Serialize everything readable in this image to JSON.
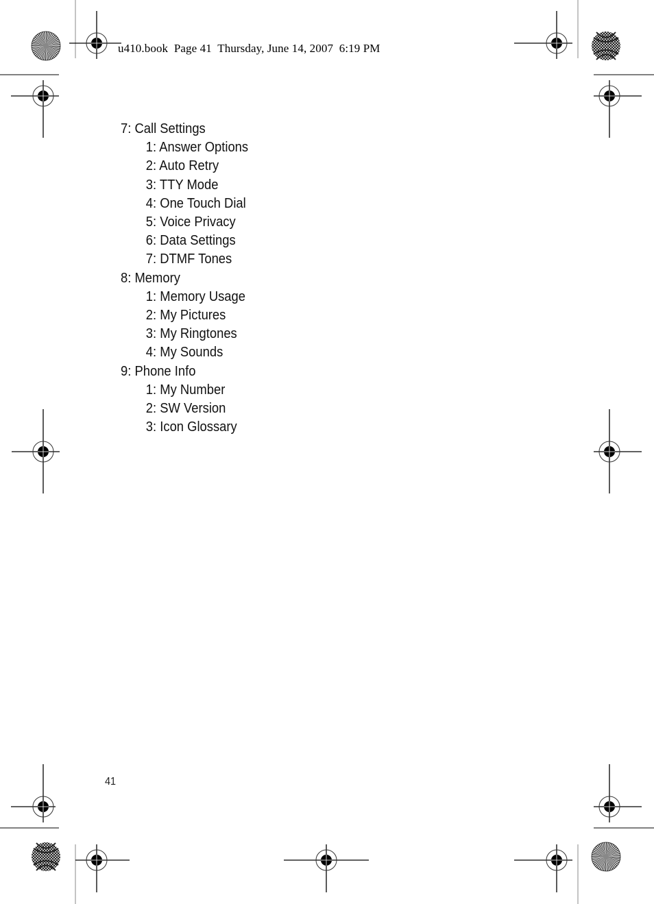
{
  "header": {
    "text": "u410.book  Page 41  Thursday, June 14, 2007  6:19 PM"
  },
  "menu": [
    {
      "label": "7: Call Settings",
      "children": [
        {
          "label": "1: Answer Options"
        },
        {
          "label": "2: Auto Retry"
        },
        {
          "label": "3: TTY Mode"
        },
        {
          "label": "4: One Touch Dial"
        },
        {
          "label": "5: Voice Privacy"
        },
        {
          "label": "6: Data Settings"
        },
        {
          "label": "7: DTMF Tones"
        }
      ]
    },
    {
      "label": "8: Memory",
      "children": [
        {
          "label": "1: Memory Usage"
        },
        {
          "label": "2: My Pictures"
        },
        {
          "label": "3: My Ringtones"
        },
        {
          "label": "4: My Sounds"
        }
      ]
    },
    {
      "label": "9: Phone Info",
      "children": [
        {
          "label": "1: My Number"
        },
        {
          "label": "2: SW Version"
        },
        {
          "label": "3: Icon Glossary"
        }
      ]
    }
  ],
  "footer": {
    "page_number": "41"
  },
  "print_marks": {
    "registration_icon": "crosshair-target-icon",
    "starburst_icon": "starburst-color-bar-icon",
    "moire_icon": "moire-color-bar-icon"
  }
}
